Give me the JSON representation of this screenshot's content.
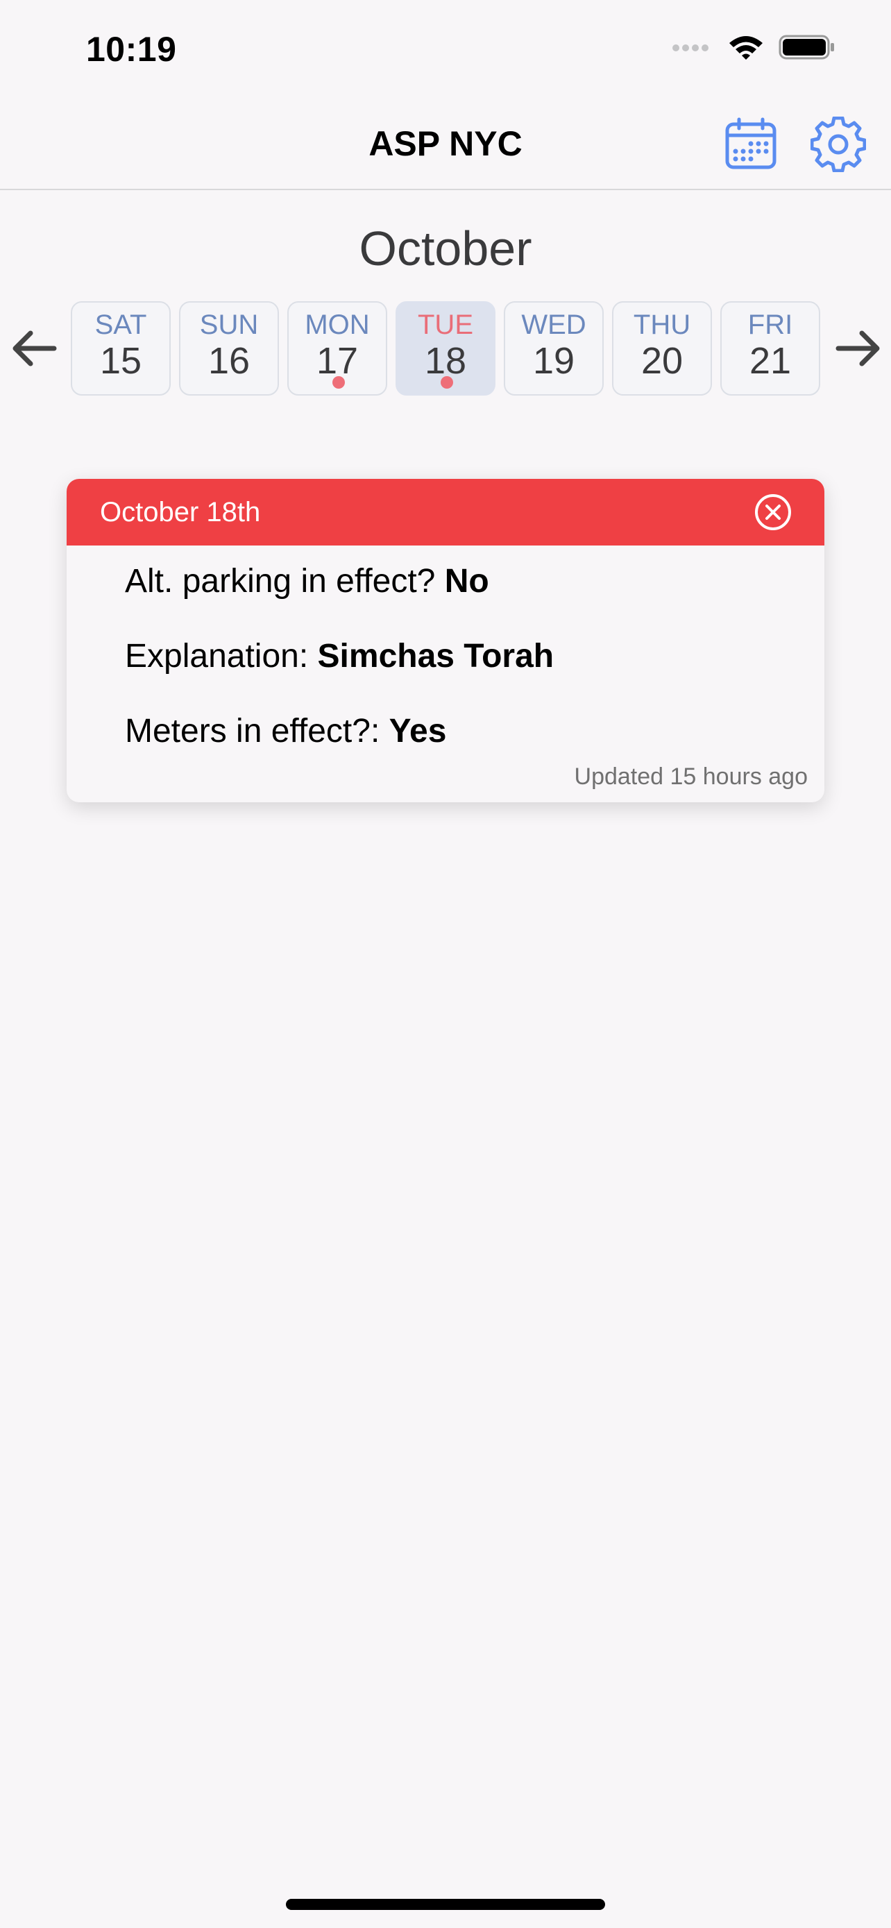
{
  "status_bar": {
    "time": "10:19"
  },
  "nav": {
    "title": "ASP NYC",
    "calendar_icon": "calendar-icon",
    "settings_icon": "gear-icon",
    "accent": "#5a8cf0"
  },
  "calendar": {
    "month": "October",
    "days": [
      {
        "name": "SAT",
        "num": "15",
        "has_event": false,
        "selected": false
      },
      {
        "name": "SUN",
        "num": "16",
        "has_event": false,
        "selected": false
      },
      {
        "name": "MON",
        "num": "17",
        "has_event": true,
        "selected": false
      },
      {
        "name": "TUE",
        "num": "18",
        "has_event": true,
        "selected": true
      },
      {
        "name": "WED",
        "num": "19",
        "has_event": false,
        "selected": false
      },
      {
        "name": "THU",
        "num": "20",
        "has_event": false,
        "selected": false
      },
      {
        "name": "FRI",
        "num": "21",
        "has_event": false,
        "selected": false
      }
    ]
  },
  "card": {
    "date": "October 18th",
    "header_color": "#ef4044",
    "asp_label": "Alt. parking in effect? ",
    "asp_value": "No",
    "explanation_label": "Explanation: ",
    "explanation_value": "Simchas Torah",
    "meters_label": "Meters in effect?: ",
    "meters_value": "Yes",
    "updated": "Updated 15 hours ago"
  }
}
